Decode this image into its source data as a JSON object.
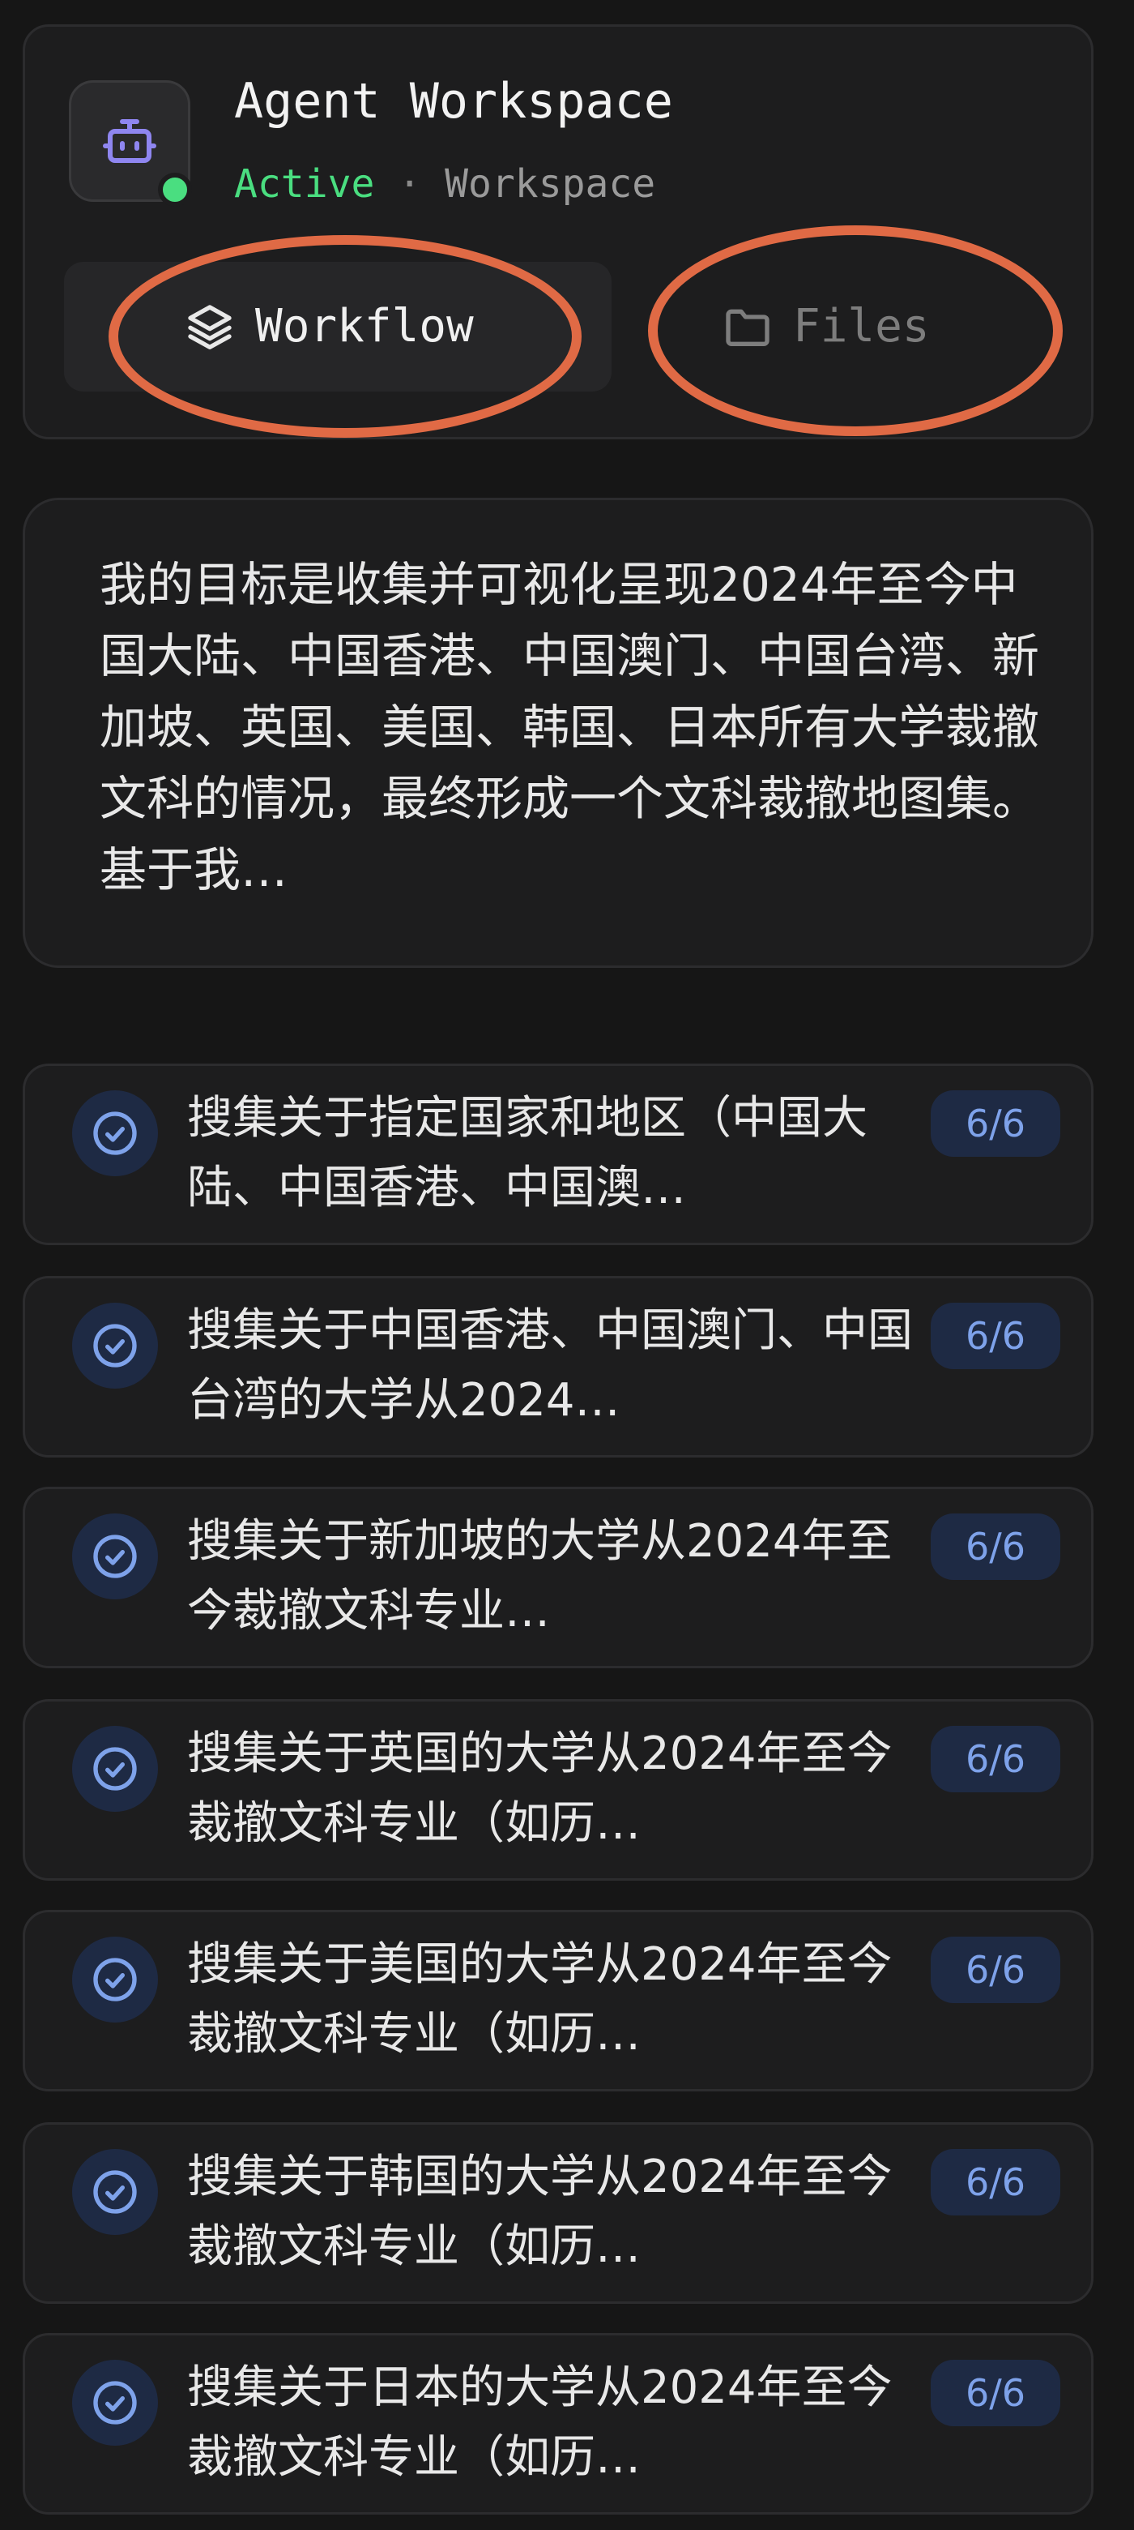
{
  "workspace": {
    "title": "Agent Workspace",
    "status": "Active",
    "separator": "·",
    "type": "Workspace"
  },
  "tabs": {
    "workflow": "Workflow",
    "files": "Files"
  },
  "goal": {
    "text": "我的目标是收集并可视化呈现2024年至今中国大陆、中国香港、中国澳门、中国台湾、新加坡、英国、美国、韩国、日本所有大学裁撤文科的情况，最终形成一个文科裁撤地图集。基于我…"
  },
  "tasks": [
    {
      "text": "搜集关于指定国家和地区（中国大陆、中国香港、中国澳…",
      "progress": "6/6"
    },
    {
      "text": "搜集关于中国香港、中国澳门、中国台湾的大学从2024…",
      "progress": "6/6"
    },
    {
      "text": "搜集关于新加坡的大学从2024年至今裁撤文科专业…",
      "progress": "6/6"
    },
    {
      "text": "搜集关于英国的大学从2024年至今裁撤文科专业（如历…",
      "progress": "6/6"
    },
    {
      "text": "搜集关于美国的大学从2024年至今裁撤文科专业（如历…",
      "progress": "6/6"
    },
    {
      "text": "搜集关于韩国的大学从2024年至今裁撤文科专业（如历…",
      "progress": "6/6"
    },
    {
      "text": "搜集关于日本的大学从2024年至今裁撤文科专业（如历…",
      "progress": "6/6"
    }
  ],
  "colors": {
    "background": "#161616",
    "card": "#1d1d1e",
    "active_green": "#4ade80",
    "badge_blue": "#7ea2ea",
    "annotation_orange": "#e06a45"
  },
  "icons": {
    "avatar": "robot-icon",
    "workflow_tab": "layers-icon",
    "files_tab": "folder-icon",
    "task": "check-circle-icon"
  }
}
